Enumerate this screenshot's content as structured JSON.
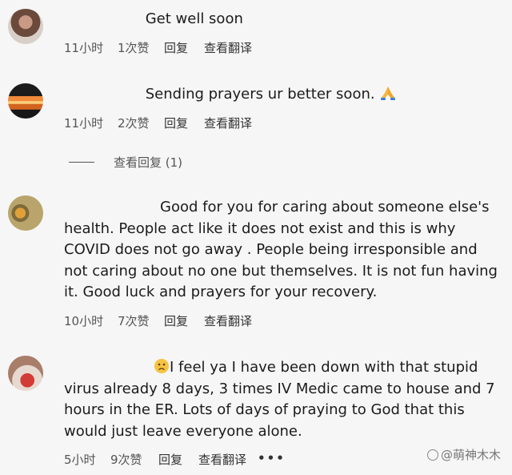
{
  "comments": [
    {
      "text": "Get well soon",
      "time": "11小时",
      "likes": "1次赞",
      "reply": "回复",
      "translate": "查看翻译"
    },
    {
      "text": "Sending prayers ur better soon.",
      "time": "11小时",
      "likes": "2次赞",
      "reply": "回复",
      "translate": "查看翻译",
      "view_replies": "查看回复 (1)"
    },
    {
      "text": "Good for you for caring about someone else's health. People act like it does not exist and this is why COVID does not go away . People being irresponsible and not caring about no one but themselves. It is not fun having it. Good luck and prayers for your recovery.",
      "time": "10小时",
      "likes": "7次赞",
      "reply": "回复",
      "translate": "查看翻译"
    },
    {
      "text": "I feel ya I have been down with that stupid virus already 8 days, 3 times IV Medic came to house and 7 hours in the ER. Lots of days of praying to God that this would just leave everyone alone.",
      "time": "5小时",
      "likes": "9次赞",
      "reply": "回复",
      "translate": "查看翻译",
      "more": "•••"
    }
  ],
  "watermark": "@萌神木木",
  "icons": {
    "emoji_1": "folded-hands-emoji",
    "emoji_2": "sad-face-emoji",
    "watermark_icon": "camera-icon"
  }
}
